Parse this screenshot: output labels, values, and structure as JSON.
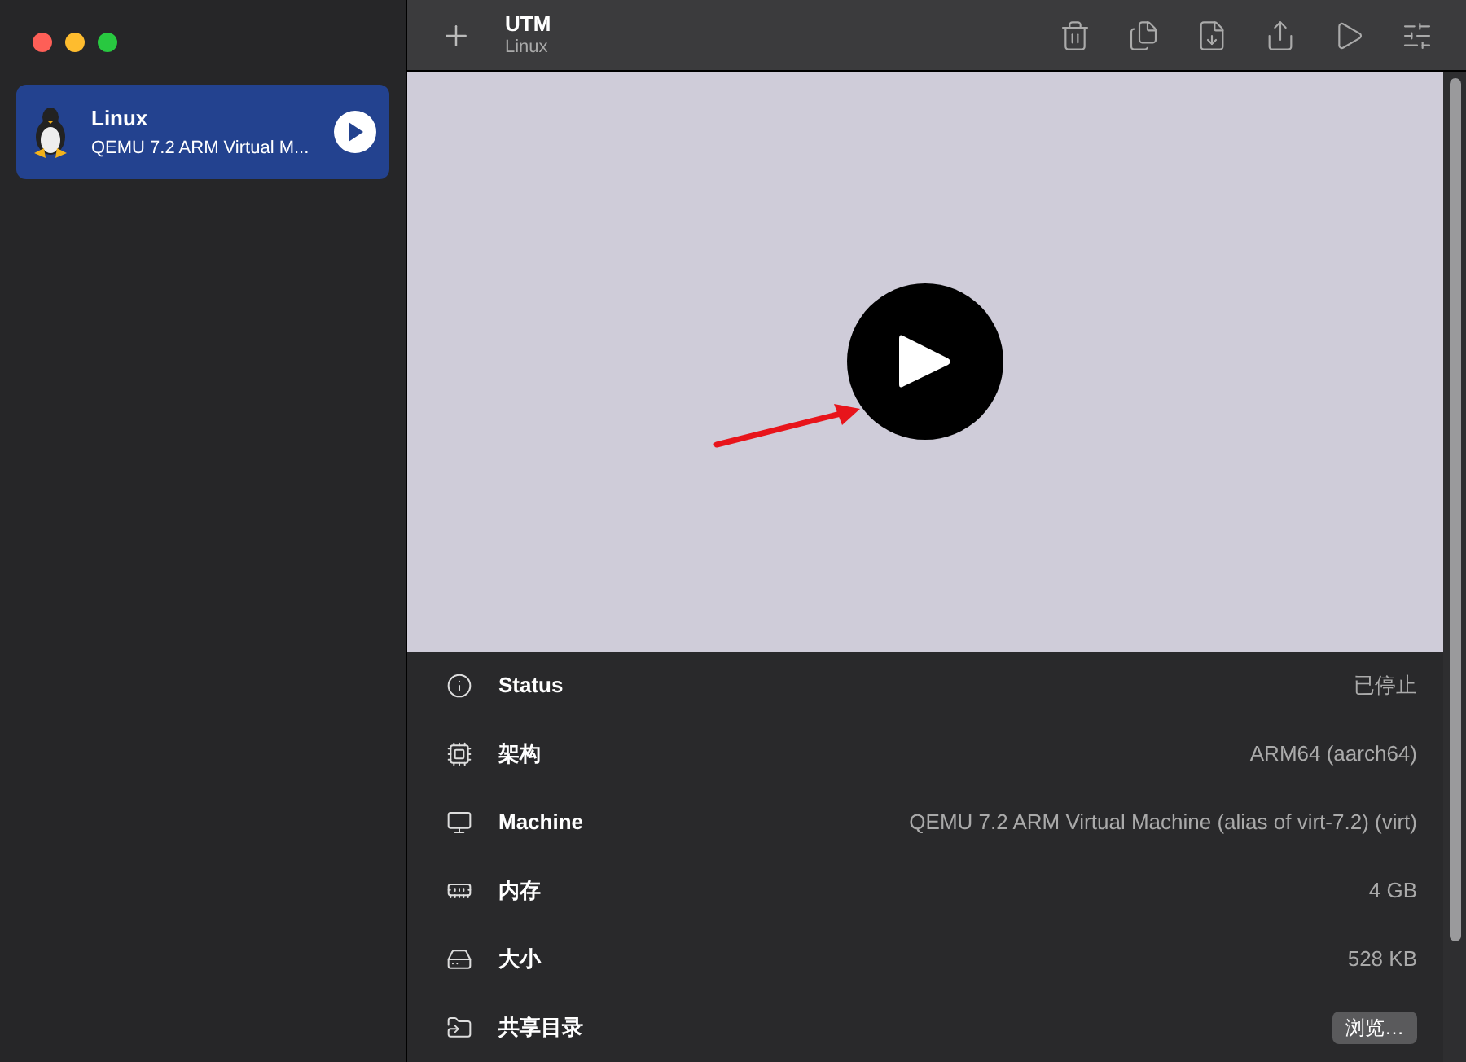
{
  "sidebar": {
    "items": [
      {
        "name": "Linux",
        "subtitle": "QEMU 7.2 ARM Virtual M...",
        "selected": true
      }
    ]
  },
  "toolbar": {
    "title": "UTM",
    "subtitle": "Linux"
  },
  "details": [
    {
      "kind": "info",
      "label": "Status",
      "value": "已停止"
    },
    {
      "kind": "chip",
      "label": "架构",
      "value": "ARM64 (aarch64)"
    },
    {
      "kind": "display",
      "label": "Machine",
      "value": "QEMU 7.2 ARM Virtual Machine (alias of virt-7.2) (virt)"
    },
    {
      "kind": "memory",
      "label": "内存",
      "value": "4 GB"
    },
    {
      "kind": "disk",
      "label": "大小",
      "value": "528 KB"
    },
    {
      "kind": "shared",
      "label": "共享目录",
      "button": "浏览…"
    }
  ]
}
